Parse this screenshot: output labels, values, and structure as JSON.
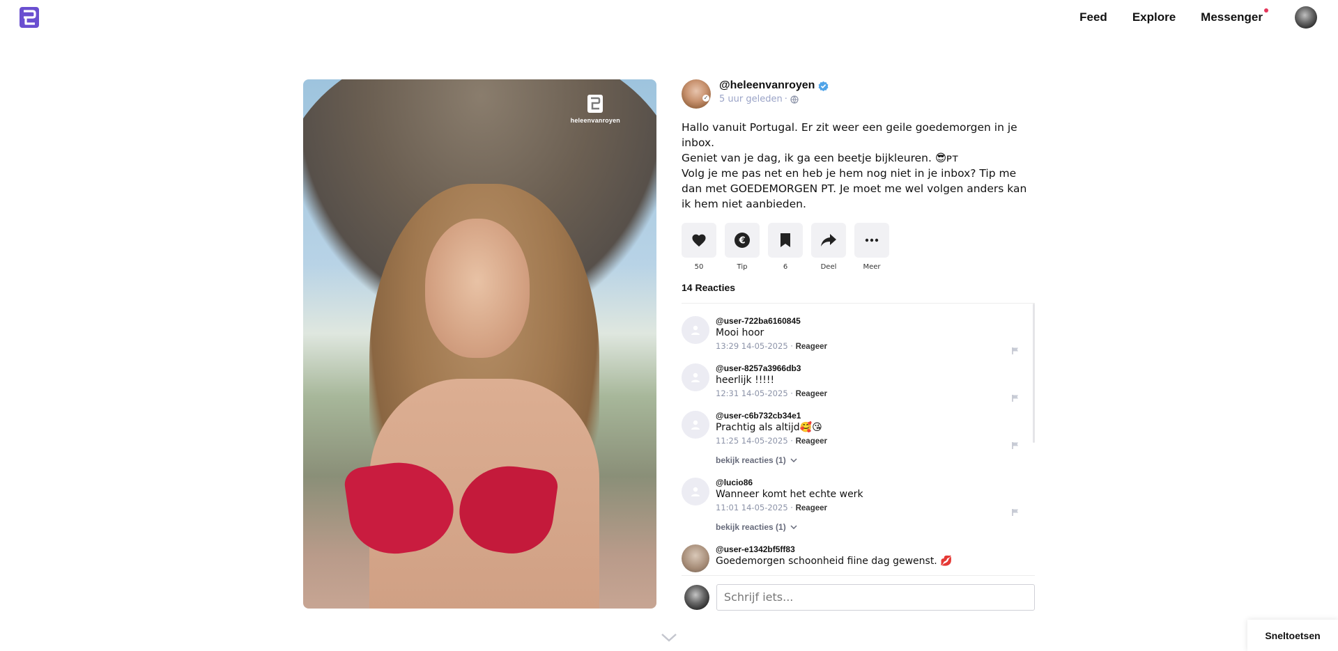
{
  "header": {
    "logo_icon": "platform-logo-icon",
    "nav": [
      {
        "label": "Feed"
      },
      {
        "label": "Explore"
      },
      {
        "label": "Messenger",
        "has_notification": true
      }
    ],
    "accent_color": "#6a4fd0",
    "notification_color": "#e5355b"
  },
  "post": {
    "watermark_text": "heleenvanroyen",
    "author": {
      "handle": "@heleenvanroyen",
      "verified": true,
      "time_ago": "5 uur geleden",
      "separator": "·",
      "visibility_icon": "globe-icon"
    },
    "text": "Hallo vanuit Portugal. Er zit weer een geile goedemorgen in je inbox.\nGeniet van je dag, ik ga een beetje bijkleuren. 😎ᴘᴛ\nVolg je me pas net en heb je hem nog niet in je inbox? Tip me dan met  GOEDEMORGEN PT. Je moet me wel volgen anders kan ik hem niet aanbieden.",
    "actions": [
      {
        "icon": "heart-icon",
        "label": "50"
      },
      {
        "icon": "euro-coin-icon",
        "label": "Tip"
      },
      {
        "icon": "bookmark-icon",
        "label": "6"
      },
      {
        "icon": "share-icon",
        "label": "Deel"
      },
      {
        "icon": "more-dots-icon",
        "label": "Meer"
      }
    ]
  },
  "comments": {
    "title": "14 Reacties",
    "reply_label": "Reageer",
    "items": [
      {
        "user": "@user-722ba6160845",
        "text": "Mooi hoor",
        "timestamp": "13:29 14-05-2025",
        "replies": ""
      },
      {
        "user": "@user-8257a3966db3",
        "text": "heerlijk !!!!!",
        "timestamp": "12:31 14-05-2025",
        "replies": ""
      },
      {
        "user": "@user-c6b732cb34e1",
        "text": "Prachtig als altijd🥰😘",
        "timestamp": "11:25 14-05-2025",
        "replies": "bekijk reacties (1)"
      },
      {
        "user": "@lucio86",
        "text": "Wanneer komt het echte werk",
        "timestamp": "11:01 14-05-2025",
        "replies": "bekijk reacties (1)"
      },
      {
        "user": "@user-e1342bf5ff83",
        "text": "Goedemorgen schoonheid fiine dag gewenst. 💋",
        "timestamp": "",
        "replies": ""
      }
    ]
  },
  "composer": {
    "placeholder": "Schrijf iets..."
  },
  "footer": {
    "shortcuts_label": "Sneltoetsen"
  }
}
